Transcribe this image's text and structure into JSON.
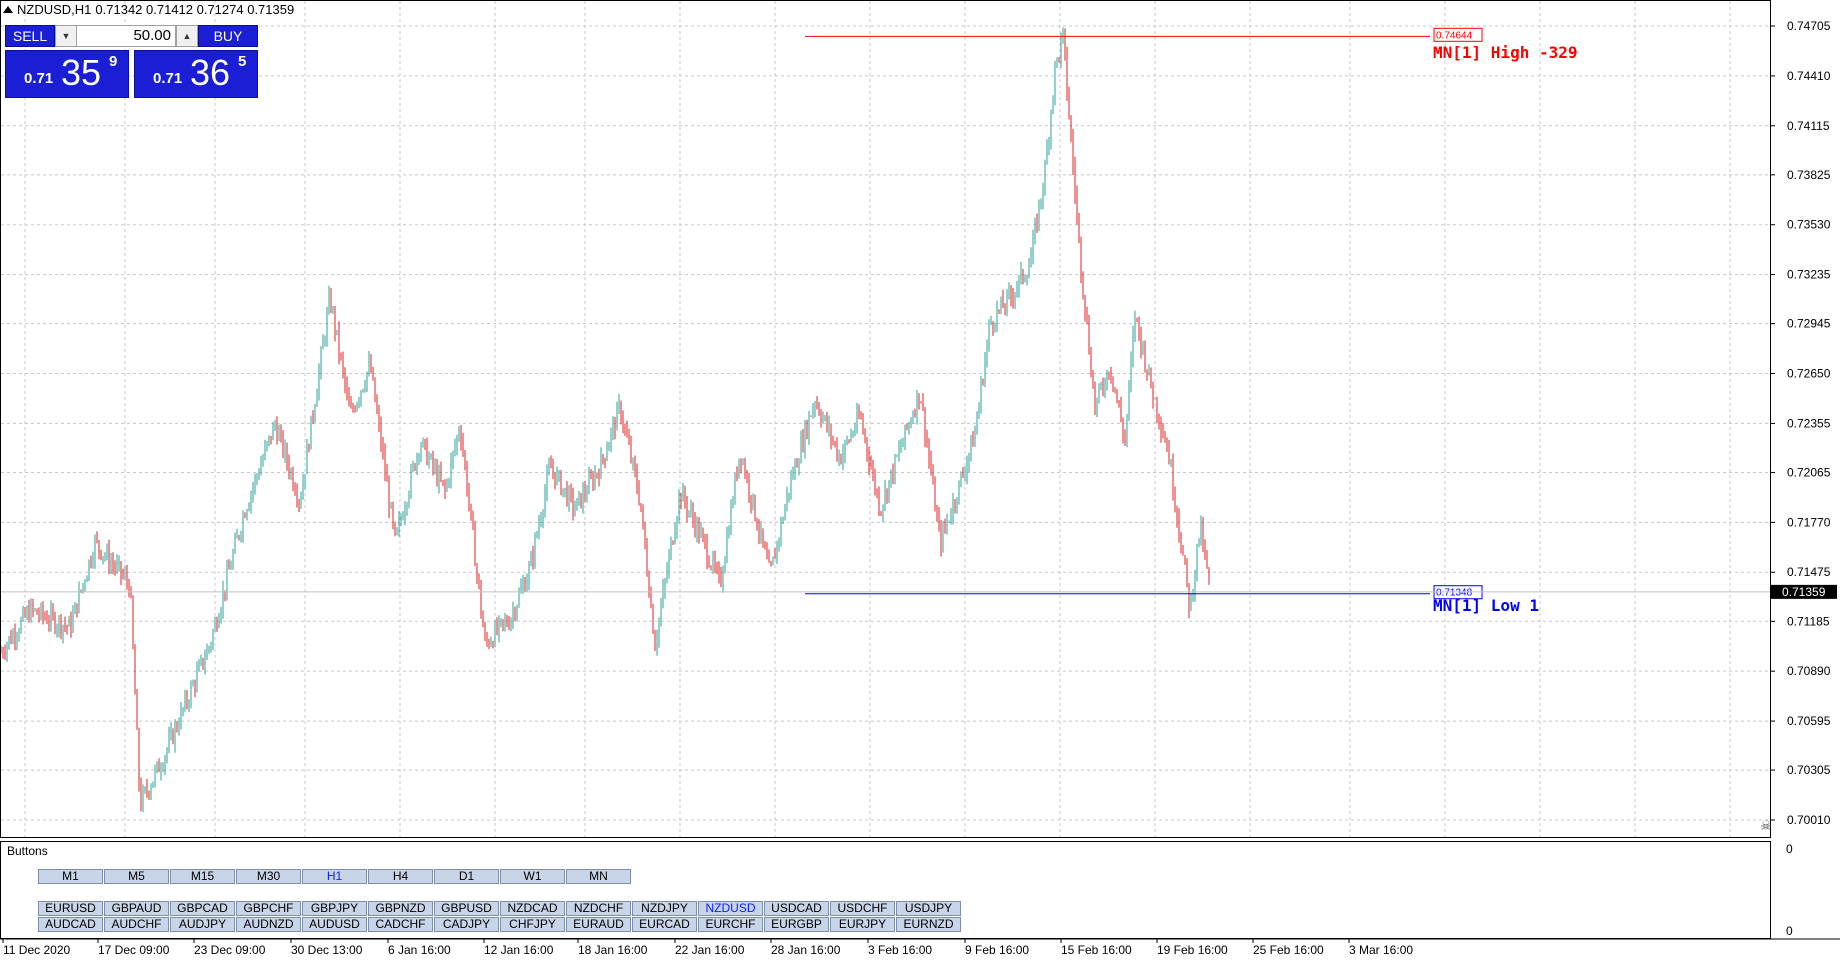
{
  "header": {
    "symbol_tf": "NZDUSD,H1",
    "ohlc": "0.71342 0.71412 0.71274 0.71359"
  },
  "trade_panel": {
    "sell_label": "SELL",
    "buy_label": "BUY",
    "lot": "50.00",
    "sell_price": {
      "small": "0.71",
      "big": "35",
      "sup": "9"
    },
    "buy_price": {
      "small": "0.71",
      "big": "36",
      "sup": "5"
    }
  },
  "price_axis": {
    "labels": [
      "0.74705",
      "0.74410",
      "0.74115",
      "0.73825",
      "0.73530",
      "0.73235",
      "0.72945",
      "0.72650",
      "0.72355",
      "0.72065",
      "0.71770",
      "0.71475",
      "0.71185",
      "0.70890",
      "0.70595",
      "0.70305",
      "0.70010"
    ],
    "current": "0.71359"
  },
  "time_axis": {
    "labels": [
      "11 Dec 2020",
      "17 Dec 09:00",
      "23 Dec 09:00",
      "30 Dec 13:00",
      "6 Jan 16:00",
      "12 Jan 16:00",
      "18 Jan 16:00",
      "22 Jan 16:00",
      "28 Jan 16:00",
      "3 Feb 16:00",
      "9 Feb 16:00",
      "15 Feb 16:00",
      "19 Feb 16:00",
      "25 Feb 16:00",
      "3 Mar 16:00"
    ]
  },
  "levels": {
    "high": {
      "price": "0.74644",
      "label": "MN[1] High  -329",
      "color": "#ff0000"
    },
    "low": {
      "price": "0.71348",
      "label": "MN[1] Low  1",
      "color": "#0000ff"
    }
  },
  "indicator_pane": {
    "title": "Buttons",
    "axis_top": "0",
    "axis_bottom": "0",
    "timeframes": [
      "M1",
      "M5",
      "M15",
      "M30",
      "H1",
      "H4",
      "D1",
      "W1",
      "MN"
    ],
    "active_tf": "H1",
    "pairs_row1": [
      "EURUSD",
      "GBPAUD",
      "GBPCAD",
      "GBPCHF",
      "GBPJPY",
      "GBPNZD",
      "GBPUSD",
      "NZDCAD",
      "NZDCHF",
      "NZDJPY",
      "NZDUSD",
      "USDCAD",
      "USDCHF",
      "USDJPY"
    ],
    "pairs_row2": [
      "AUDCAD",
      "AUDCHF",
      "AUDJPY",
      "AUDNZD",
      "AUDUSD",
      "CADCHF",
      "CADJPY",
      "CHFJPY",
      "EURAUD",
      "EURCAD",
      "EURCHF",
      "EURGBP",
      "EURJPY",
      "EURNZD"
    ],
    "active_pair": "NZDUSD"
  },
  "chart_data": {
    "type": "candlestick",
    "symbol": "NZDUSD",
    "timeframe": "H1",
    "ylim": [
      0.6996,
      0.748
    ],
    "grid": true,
    "colors": {
      "bull": "#2aa198",
      "bear": "#e02020"
    },
    "price_path": [
      [
        0,
        0.71
      ],
      [
        30,
        0.7125
      ],
      [
        70,
        0.7115
      ],
      [
        95,
        0.7165
      ],
      [
        130,
        0.714
      ],
      [
        140,
        0.701
      ],
      [
        165,
        0.704
      ],
      [
        210,
        0.7105
      ],
      [
        245,
        0.7185
      ],
      [
        275,
        0.7235
      ],
      [
        300,
        0.719
      ],
      [
        330,
        0.731
      ],
      [
        350,
        0.724
      ],
      [
        370,
        0.727
      ],
      [
        395,
        0.7165
      ],
      [
        420,
        0.7225
      ],
      [
        445,
        0.7195
      ],
      [
        460,
        0.7235
      ],
      [
        485,
        0.7105
      ],
      [
        510,
        0.712
      ],
      [
        530,
        0.715
      ],
      [
        550,
        0.721
      ],
      [
        575,
        0.7185
      ],
      [
        600,
        0.721
      ],
      [
        620,
        0.7245
      ],
      [
        640,
        0.719
      ],
      [
        655,
        0.7105
      ],
      [
        680,
        0.7195
      ],
      [
        700,
        0.717
      ],
      [
        720,
        0.714
      ],
      [
        740,
        0.722
      ],
      [
        770,
        0.7145
      ],
      [
        790,
        0.72
      ],
      [
        815,
        0.725
      ],
      [
        840,
        0.7215
      ],
      [
        860,
        0.724
      ],
      [
        880,
        0.7185
      ],
      [
        900,
        0.722
      ],
      [
        920,
        0.7255
      ],
      [
        940,
        0.7165
      ],
      [
        960,
        0.72
      ],
      [
        975,
        0.723
      ],
      [
        990,
        0.7295
      ],
      [
        1010,
        0.731
      ],
      [
        1030,
        0.733
      ],
      [
        1045,
        0.7385
      ],
      [
        1055,
        0.7445
      ],
      [
        1063,
        0.7464
      ],
      [
        1070,
        0.741
      ],
      [
        1080,
        0.7335
      ],
      [
        1095,
        0.7245
      ],
      [
        1110,
        0.727
      ],
      [
        1125,
        0.7225
      ],
      [
        1135,
        0.73
      ],
      [
        1150,
        0.726
      ],
      [
        1168,
        0.722
      ],
      [
        1180,
        0.717
      ],
      [
        1190,
        0.7125
      ],
      [
        1200,
        0.7175
      ],
      [
        1210,
        0.7136
      ]
    ]
  }
}
